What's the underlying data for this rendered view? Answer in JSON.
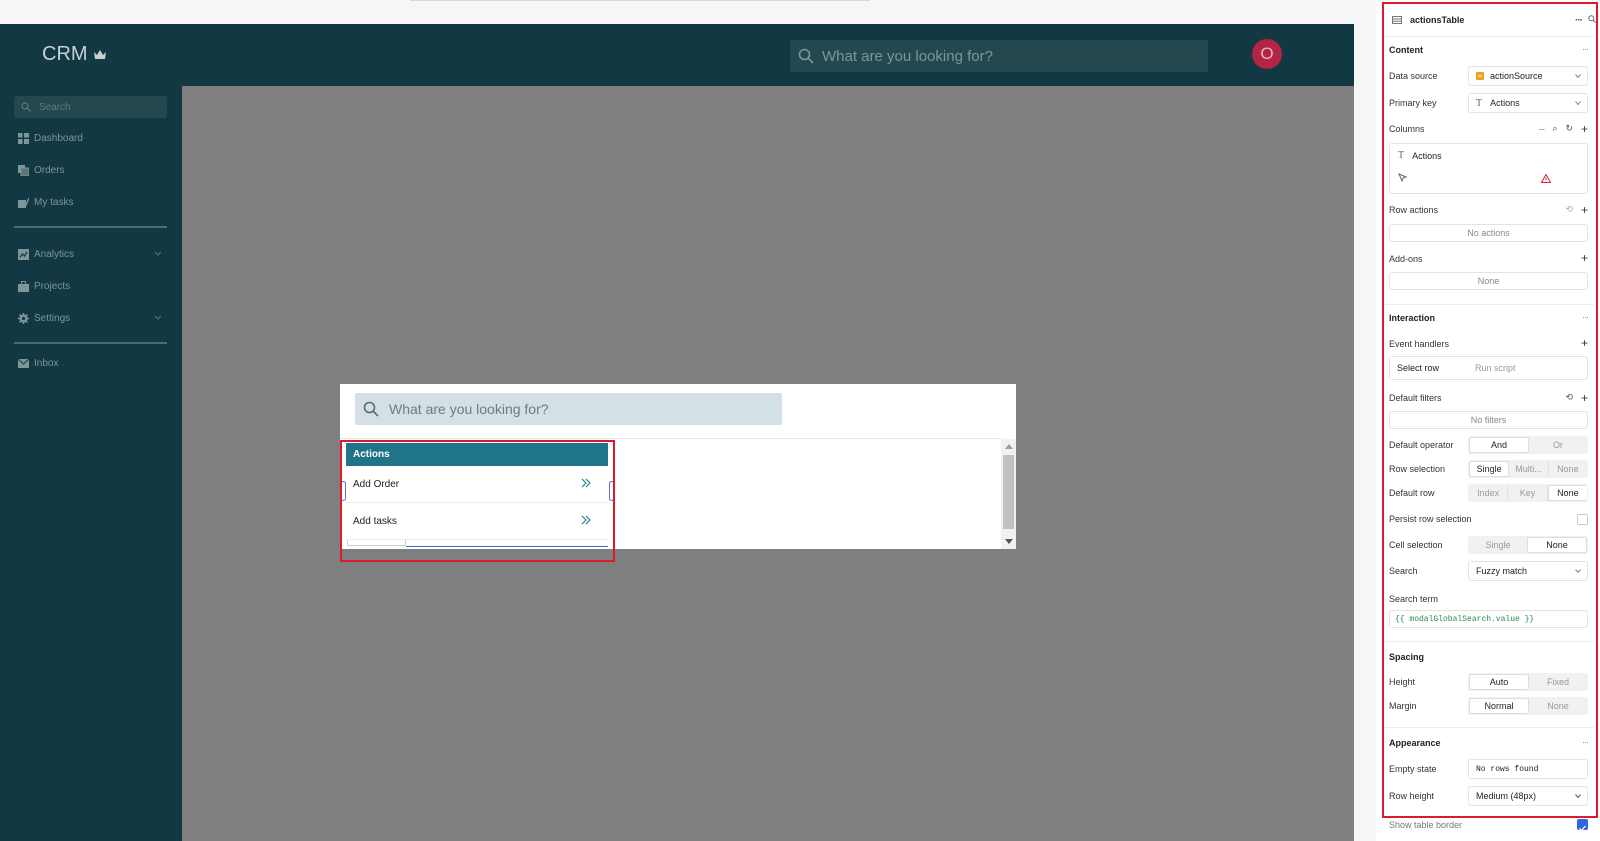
{
  "app": {
    "brand": "CRM",
    "header_search_placeholder": "What are you looking for?",
    "avatar_initial": "O",
    "sidebar": {
      "search_placeholder": "Search",
      "items": [
        {
          "label": "Dashboard",
          "icon": "grid-icon"
        },
        {
          "label": "Orders",
          "icon": "orders-icon"
        },
        {
          "label": "My tasks",
          "icon": "tasks-icon"
        },
        {
          "label": "Analytics",
          "icon": "chart-icon"
        },
        {
          "label": "Projects",
          "icon": "briefcase-icon"
        },
        {
          "label": "Settings",
          "icon": "gear-icon"
        },
        {
          "label": "Inbox",
          "icon": "mail-icon"
        }
      ]
    },
    "modal": {
      "search_placeholder": "What are you looking for?",
      "table": {
        "header": "Actions",
        "rows": [
          "Add Order",
          "Add tasks"
        ]
      }
    }
  },
  "inspector": {
    "component_name": "actionsTable",
    "content": {
      "title": "Content",
      "data_source_label": "Data source",
      "data_source_value": "actionSource",
      "primary_key_label": "Primary key",
      "primary_key_value": "Actions",
      "columns_label": "Columns",
      "column_name": "Actions",
      "row_actions_label": "Row actions",
      "row_actions_empty": "No actions",
      "addons_label": "Add-ons",
      "addons_empty": "None"
    },
    "interaction": {
      "title": "Interaction",
      "event_handlers_label": "Event handlers",
      "event_name": "Select row",
      "event_action": "Run script",
      "default_filters_label": "Default filters",
      "filters_empty": "No filters",
      "default_operator_label": "Default operator",
      "operator_options": [
        "And",
        "Or"
      ],
      "row_selection_label": "Row selection",
      "row_selection_options": [
        "Single",
        "Multi...",
        "None"
      ],
      "default_row_label": "Default row",
      "default_row_options": [
        "Index",
        "Key",
        "None"
      ],
      "persist_row_label": "Persist row selection",
      "cell_selection_label": "Cell selection",
      "cell_selection_options": [
        "Single",
        "None"
      ],
      "search_label": "Search",
      "search_value": "Fuzzy match",
      "search_term_label": "Search term",
      "search_term_value": "{{ modalGlobalSearch.value }}"
    },
    "spacing": {
      "title": "Spacing",
      "height_label": "Height",
      "height_options": [
        "Auto",
        "Fixed"
      ],
      "margin_label": "Margin",
      "margin_options": [
        "Normal",
        "None"
      ]
    },
    "appearance": {
      "title": "Appearance",
      "empty_state_label": "Empty state",
      "empty_state_value": "No rows found",
      "row_height_label": "Row height",
      "row_height_value": "Medium (48px)",
      "show_border_label": "Show table border"
    }
  },
  "colors": {
    "header_bg": "#123843",
    "table_header": "#1f7489",
    "highlight": "#e0182d",
    "avatar": "#b22544",
    "accent": "#2d6ae0"
  }
}
